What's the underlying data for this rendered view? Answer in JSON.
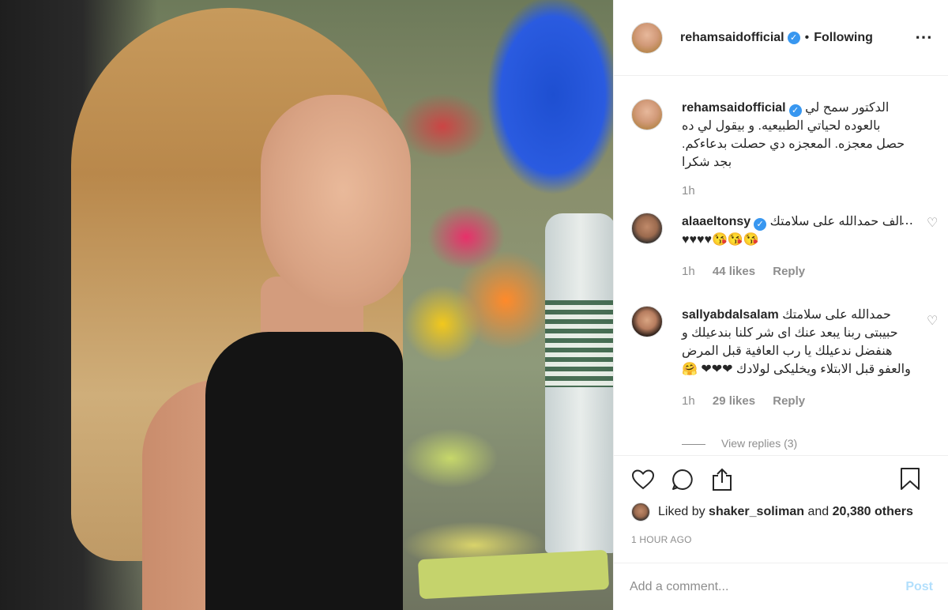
{
  "post": {
    "author": "rehamsaidofficial",
    "follow_status": "Following",
    "caption_text": "الدكتور سمح لي بالعوده لحياتي الطبيعيه. و بيقول لي ده حصل معجزه. المعجزه دي حصلت بدعاءكم. بجد شكرا",
    "caption_time": "1h"
  },
  "comments": [
    {
      "username": "alaaeltonsy",
      "verified": true,
      "text": "الف حمدالله على سلامتك 😘😘😘♥♥♥♥",
      "time": "1h",
      "likes": "44 likes",
      "reply": "Reply"
    },
    {
      "username": "sallyabdalsalam",
      "verified": false,
      "text": "حمدالله على سلامتك حبيبتى ربنا يبعد عنك اى شر كلنا بندعيلك و هنفضل ندعيلك يا رب العافية قبل المرض والعفو قبل الابتلاء ويخليكى لولادك ❤❤❤ 🤗",
      "time": "1h",
      "likes": "29 likes",
      "reply": "Reply"
    }
  ],
  "view_replies": "View replies (3)",
  "likes": {
    "prefix": "Liked by",
    "user": "shaker_soliman",
    "and": "and",
    "others": "20,380 others"
  },
  "timestamp": "1 HOUR AGO",
  "composer": {
    "placeholder": "Add a comment...",
    "post_label": "Post"
  },
  "icons": {
    "verified": "verified-badge-icon",
    "more": "more-options-icon",
    "like": "heart-icon",
    "comment": "comment-icon",
    "share": "share-icon",
    "save": "bookmark-icon"
  },
  "colors": {
    "verified": "#3897f0",
    "post_disabled": "#b2dffc",
    "muted": "#8e8e8e"
  }
}
